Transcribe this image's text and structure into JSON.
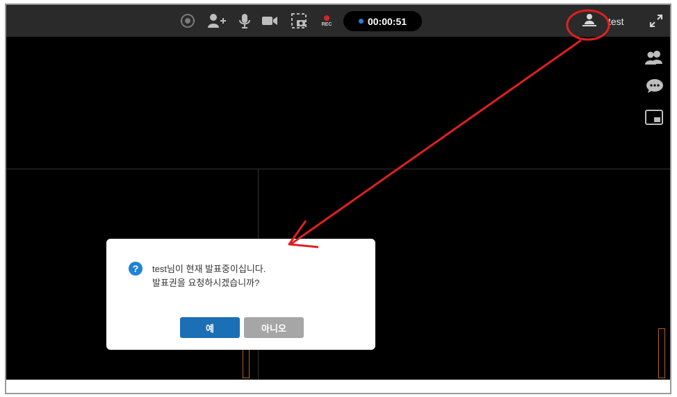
{
  "toolbar": {
    "icons": {
      "switch_camera": "switch-camera-icon",
      "add_user": "add-user-icon",
      "mic": "microphone-icon",
      "video": "video-camera-icon",
      "capture": "screen-capture-icon",
      "record": "record-icon",
      "presenter": "presenter-icon",
      "expand": "expand-icon"
    },
    "record_label": "REC",
    "timer": "00:00:51",
    "username": "test"
  },
  "side_panel": {
    "icons": [
      "participants-icon",
      "chat-icon",
      "picture-in-picture-icon"
    ]
  },
  "dialog": {
    "line1": "test님이 현재 발표중이십니다.",
    "line2": "발표권을 요청하시겠습니까?",
    "yes_label": "예",
    "no_label": "아니오"
  },
  "colors": {
    "toolbar_bg": "#2a2a2a",
    "stage_bg": "#000000",
    "accent_blue": "#1a6fb5",
    "annotation_red": "#e02020",
    "record_red": "#d0262b"
  }
}
